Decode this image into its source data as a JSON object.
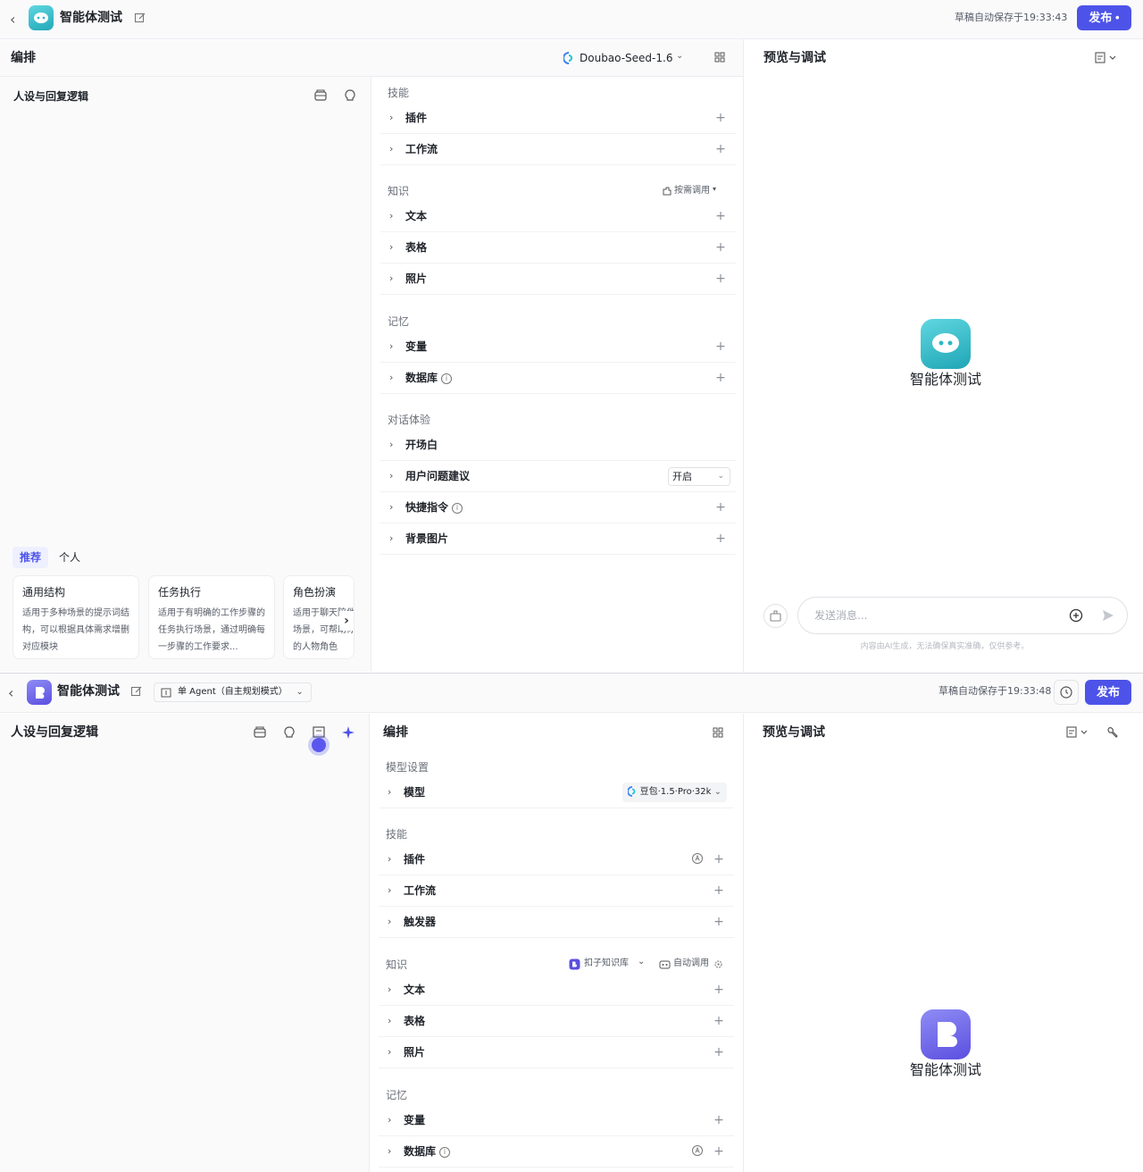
{
  "colors": {
    "accent": "#4d53e8",
    "teal_icon": "#2fb8c8",
    "purple_icon": "#5b4fe0"
  },
  "shot1": {
    "app_title": "智能体测试",
    "saved": "草稿自动保存于19:33:43",
    "publish": "发布",
    "editor_title": "编排",
    "model": "Doubao-Seed-1.6",
    "preview_title": "预览与调试",
    "persona_title": "人设与回复逻辑",
    "tabs": [
      "推荐",
      "个人"
    ],
    "cards": [
      {
        "title": "通用结构",
        "desc": "适用于多种场景的提示词结构，可以根据具体需求增删对应模块"
      },
      {
        "title": "任务执行",
        "desc": "适用于有明确的工作步骤的任务执行场景，通过明确每一步骤的工作要求..."
      },
      {
        "title": "角色扮演",
        "desc": "适用于聊天陪伴、互动娱乐场景，可帮助你塑造个性化的人物角色"
      }
    ],
    "sections": {
      "skills": "技能",
      "knowledge": "知识",
      "knowledge_mode": "按需调用",
      "memory": "记忆",
      "dialog": "对话体验"
    },
    "rows": {
      "plugin": "插件",
      "workflow": "工作流",
      "text": "文本",
      "table": "表格",
      "photo": "照片",
      "variable": "变量",
      "database": "数据库",
      "opening": "开场白",
      "suggest": "用户问题建议",
      "suggest_value": "开启",
      "shortcut": "快捷指令",
      "background": "背景图片"
    },
    "chat_placeholder": "发送消息...",
    "disclaimer": "内容由AI生成，无法确保真实准确，仅供参考。",
    "agent_name": "智能体测试"
  },
  "shot2": {
    "app_title": "智能体测试",
    "mode": "单 Agent（自主规划模式）",
    "saved": "草稿自动保存于19:33:48",
    "publish": "发布",
    "persona_title": "人设与回复逻辑",
    "editor_title": "编排",
    "preview_title": "预览与调试",
    "sections": {
      "model": "模型设置",
      "skills": "技能",
      "knowledge": "知识",
      "knowledge_source": "扣子知识库",
      "knowledge_mode": "自动调用",
      "memory": "记忆"
    },
    "rows": {
      "model": "模型",
      "model_value": "豆包·1.5·Pro·32k",
      "plugin": "插件",
      "workflow": "工作流",
      "trigger": "触发器",
      "text": "文本",
      "table": "表格",
      "photo": "照片",
      "variable": "变量",
      "database": "数据库"
    },
    "agent_name": "智能体测试"
  }
}
